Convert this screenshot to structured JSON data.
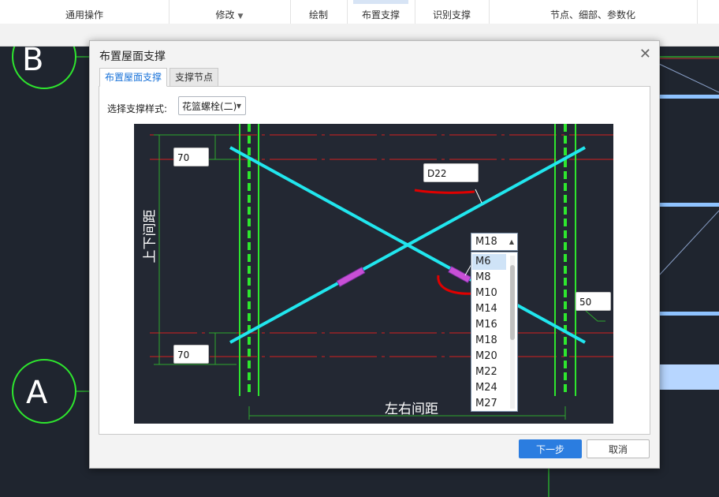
{
  "ribbon": {
    "groups": [
      {
        "label": "通用操作"
      },
      {
        "label": "修改"
      },
      {
        "label": "绘制"
      },
      {
        "label": "布置支撑"
      },
      {
        "label": "识别支撑"
      },
      {
        "label": "节点、细部、参数化"
      }
    ]
  },
  "canvas": {
    "axis_b": "B",
    "axis_a": "A"
  },
  "dialog": {
    "title": "布置屋面支撑",
    "tabs": [
      {
        "label": "布置屋面支撑",
        "active": true
      },
      {
        "label": "支撑节点",
        "active": false
      }
    ],
    "style_label": "选择支撑样式:",
    "style_value": "花篮螺栓(二)",
    "drawing": {
      "top_spacing": "70",
      "bottom_spacing": "70",
      "diameter": "D22",
      "offset": "50",
      "vertical_dim_label": "上下间距",
      "horizontal_dim_label": "左右间距"
    },
    "bolt_select": {
      "value": "M18",
      "options": [
        "M6",
        "M8",
        "M10",
        "M14",
        "M16",
        "M18",
        "M20",
        "M22",
        "M24",
        "M27"
      ],
      "highlighted": "M6"
    },
    "next_button": "下一步",
    "cancel_button": "取消"
  },
  "colors": {
    "primary_button": "#2b7de0",
    "brace_line": "#21e6ee",
    "column_line": "#2ee62e",
    "axis_circle": "#2ee62e",
    "red_annotation": "#e00000",
    "turnbuckle": "#c84fd6"
  }
}
